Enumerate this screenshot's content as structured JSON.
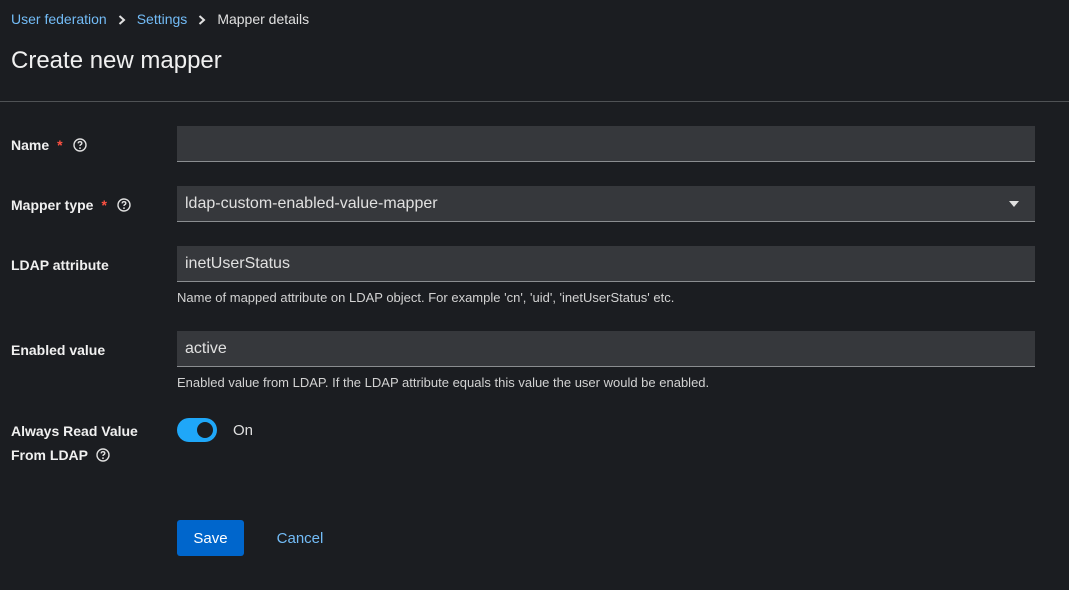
{
  "breadcrumb": {
    "items": [
      "User federation",
      "Settings"
    ],
    "current": "Mapper details"
  },
  "page": {
    "title": "Create new mapper"
  },
  "form": {
    "name": {
      "label": "Name",
      "required_mark": "*",
      "value": ""
    },
    "mapper_type": {
      "label": "Mapper type",
      "required_mark": "*",
      "value": "ldap-custom-enabled-value-mapper"
    },
    "ldap_attribute": {
      "label": "LDAP attribute",
      "value": "inetUserStatus",
      "helper": "Name of mapped attribute on LDAP object. For example 'cn', 'uid', 'inetUserStatus' etc."
    },
    "enabled_value": {
      "label": "Enabled value",
      "value": "active",
      "helper": "Enabled value from LDAP. If the LDAP attribute equals this value the user would be enabled."
    },
    "always_read": {
      "label_line1": "Always Read Value",
      "label_line2": "From LDAP",
      "toggle_state": "On",
      "enabled": true
    }
  },
  "actions": {
    "save_label": "Save",
    "cancel_label": "Cancel"
  },
  "colors": {
    "accent": "#0066cc",
    "link": "#73bcf7",
    "toggle_on": "#1fa7f8",
    "required": "#fe5142",
    "background": "#1b1d21"
  },
  "icons": [
    "chevron-right-icon",
    "help-icon",
    "caret-down-icon"
  ]
}
